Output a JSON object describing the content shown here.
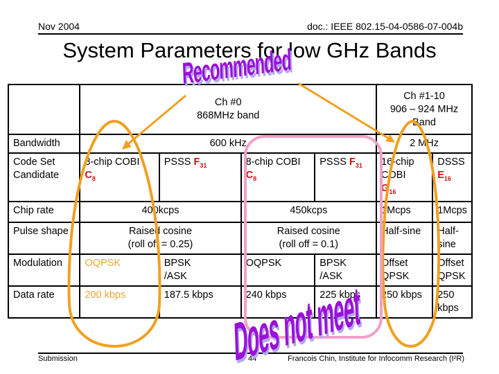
{
  "header": {
    "date": "Nov 2004",
    "doc_id": "doc.: IEEE 802.15-04-0586-07-004b"
  },
  "title": "System Parameters for low GHz Bands",
  "table": {
    "band_868": {
      "line1": "Ch #0",
      "line2": "868MHz  band"
    },
    "band_915": {
      "line1": "Ch #1-10",
      "line2": "906 – 924 MHz",
      "line3": "Band"
    },
    "rows": {
      "bandwidth": {
        "label": "Bandwidth",
        "v868": "600 kHz",
        "v915": "2 MHz"
      },
      "code_set": {
        "label_line1": "Code Set",
        "label_line2": "Candidate",
        "c1_text": "8-chip COBI",
        "c1_code": "C",
        "c1_sub": "8",
        "c2_text": "PSSS ",
        "c2_code": "F",
        "c2_sub": "31",
        "c3_text": "8-chip COBI",
        "c3_code": "C",
        "c3_sub": "8",
        "c4_text": "PSSS ",
        "c4_code": "F",
        "c4_sub": "31",
        "c5_line1": "16-chip",
        "c5_line2": "COBI",
        "c5_code": "G",
        "c5_sub": "16",
        "c6_text": "DSSS",
        "c6_code": "E",
        "c6_sub": "16"
      },
      "chip_rate": {
        "label": "Chip rate",
        "v1": "400kcps",
        "v2": "450kcps",
        "v3": "1Mcps",
        "v4": "1Mcps"
      },
      "pulse_shape": {
        "label": "Pulse shape",
        "v1_line1": "Raised cosine",
        "v1_line2": "(roll off = 0.25)",
        "v2_line1": "Raised cosine",
        "v2_line2": "(roll off = 0.1)",
        "v3": "Half-sine",
        "v4_line1": "Half-",
        "v4_line2": "sine"
      },
      "modulation": {
        "label": "Modulation",
        "c1": "OQPSK",
        "c2_line1": "BPSK",
        "c2_line2": "/ASK",
        "c3": "OQPSK",
        "c4_line1": "BPSK",
        "c4_line2": "/ASK",
        "c5_line1": "Offset",
        "c5_line2": "QPSK",
        "c6_line1": "Offset",
        "c6_line2": "QPSK"
      },
      "data_rate": {
        "label": "Data rate",
        "c1": "200 kbps",
        "c2": "187.5 kbps",
        "c3": "240 kbps",
        "c4": "225 kbps",
        "c5": "250 kbps",
        "c6_line1": "250",
        "c6_line2": "kbps"
      }
    }
  },
  "annotations": {
    "recommended": "Recommended",
    "does_not_meet": "Does not meet",
    "colors": {
      "orange": "#f0a020",
      "pink": "#f0a0c8",
      "wordart": "#9b10d8"
    }
  },
  "footer": {
    "left": "Submission",
    "page": "44",
    "author": "Francois Chin, Institute for Infocomm Research (I²R)"
  }
}
